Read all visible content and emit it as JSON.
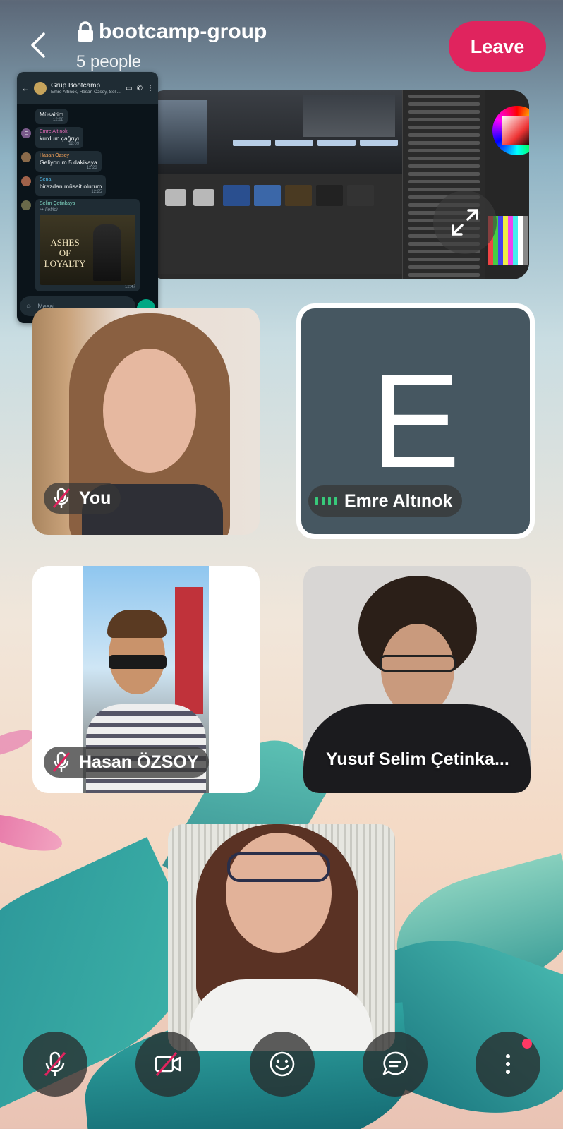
{
  "header": {
    "title": "bootcamp-group",
    "subtitle": "5 people",
    "leave_label": "Leave"
  },
  "whatsapp_preview": {
    "chat_title": "Grup Bootcamp",
    "chat_members": "Emre Altınok, Hasan Özsoy, Seli...",
    "messages": [
      {
        "sender": "",
        "text": "Müsaitim",
        "time": "12:08"
      },
      {
        "sender": "Emre Altınok",
        "text": "kurdum çağrıyı",
        "time": "12:09"
      },
      {
        "sender": "Hasan Özsoy",
        "text": "Geliyorum 5 dakikaya",
        "time": "12:23"
      },
      {
        "sender": "Sena",
        "text": "birazdan müsait olurum",
        "time": "12:25"
      },
      {
        "sender": "Selim Çetinkaya",
        "text": "↪ İletildi",
        "time": "12:47"
      }
    ],
    "poster_text": "ASHES OF LOYALTY",
    "input_placeholder": "Mesaj",
    "avatar_letter": "E"
  },
  "participants": {
    "you": {
      "name": "You",
      "muted": true
    },
    "emre": {
      "name": "Emre Altınok",
      "initial": "E",
      "speaking": true
    },
    "hasan": {
      "name": "Hasan ÖZSOY",
      "muted": true
    },
    "yusuf": {
      "name": "Yusuf Selim Çetinka..."
    },
    "fifth": {
      "name": ""
    }
  },
  "controls": {
    "mic": "mic-off-icon",
    "camera": "camera-off-icon",
    "reactions": "emoji-icon",
    "chat": "chat-icon",
    "more": "more-icon",
    "more_has_notification": true
  },
  "colors": {
    "leave": "#e0245e",
    "speaking": "#38c97a",
    "tile_placeholder": "#465761"
  }
}
